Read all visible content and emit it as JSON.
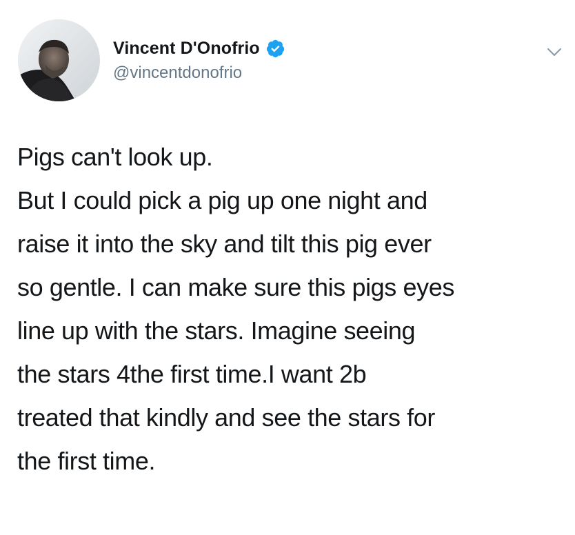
{
  "tweet": {
    "author": {
      "display_name": "Vincent D'Onofrio",
      "handle": "@vincentdonofrio",
      "verified": true,
      "avatar_icon": "profile-photo",
      "verified_icon": "verified-badge-icon"
    },
    "menu_icon": "chevron-down-icon",
    "text_lines": [
      "Pigs can't look up.",
      "But I could pick a pig up one night and",
      "raise it into the sky and tilt this pig ever",
      "so gentle. I can make sure this pigs eyes",
      "line up with the stars. Imagine seeing",
      "the stars 4the first time.I want 2b",
      "treated that kindly and see the stars for",
      "the first time."
    ]
  },
  "colors": {
    "text": "#14171a",
    "secondary": "#657786",
    "verified_blue": "#1da1f2",
    "background": "#ffffff"
  }
}
